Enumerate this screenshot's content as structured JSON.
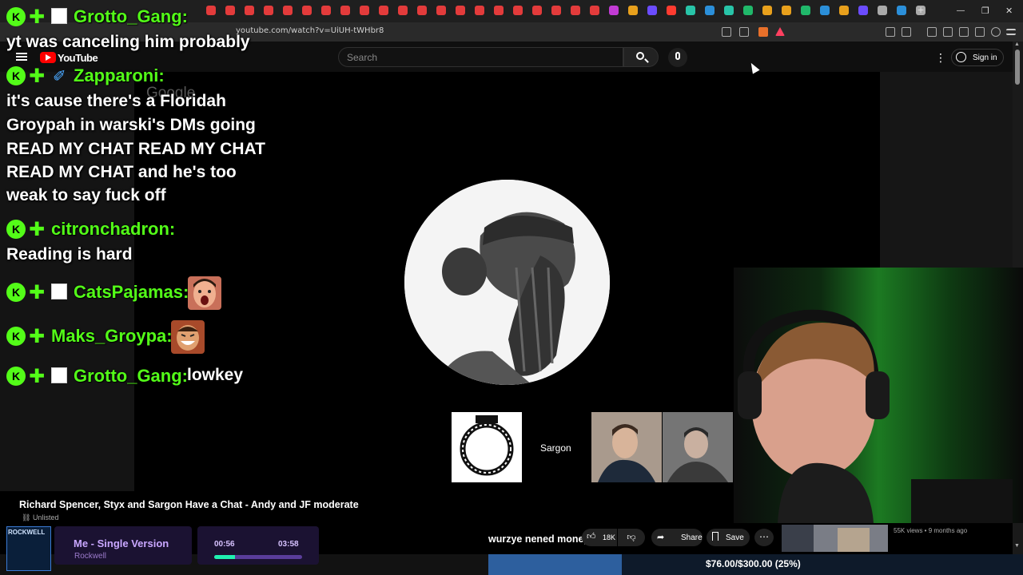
{
  "browser": {
    "url": "youtube.com/watch?v=UiUH-tWHbr8",
    "tab_icon_colors": [
      "#e33b3b",
      "#e33b3b",
      "#e33b3b",
      "#e33b3b",
      "#e33b3b",
      "#e33b3b",
      "#e33b3b",
      "#e33b3b",
      "#e33b3b",
      "#e33b3b",
      "#e33b3b",
      "#e33b3b",
      "#e33b3b",
      "#e33b3b",
      "#e33b3b",
      "#e33b3b",
      "#e33b3b",
      "#e33b3b",
      "#e33b3b",
      "#e33b3b",
      "#e33b3b",
      "#c23bd4",
      "#e8a01c",
      "#6b4cff",
      "#ff3b30",
      "#28c4a8",
      "#2b8fd9",
      "#28c4a8",
      "#20b86a",
      "#e8a01c",
      "#e8a01c",
      "#20b86a",
      "#2b8fd9",
      "#e8a01c",
      "#6b4cff",
      "#aaaaaa",
      "#2b8fd9",
      "#aaaaaa"
    ],
    "new_tab": "+",
    "minimize": "—",
    "maximize": "❐",
    "close": "✕"
  },
  "youtube": {
    "logo_text": "YouTube",
    "search_placeholder": "Search",
    "sign_in": "Sign in",
    "more": "⋮",
    "watermark": "Google"
  },
  "chat": {
    "brand_color": "#53fc18",
    "badge_letter": "K",
    "messages": [
      {
        "user": "Grotto_Gang:",
        "lines": [
          "yt was canceling him probably"
        ],
        "emote": null
      },
      {
        "user": "Zapparoni:",
        "lines": [
          "it's cause there's a Floridah",
          "Groypah in warski's DMs going",
          "READ MY CHAT READ MY CHAT",
          "READ MY CHAT and he's too",
          "weak to say fuck off"
        ],
        "emote": null
      },
      {
        "user": "citronchadron:",
        "lines": [
          "Reading is hard"
        ],
        "emote": null
      },
      {
        "user": "CatsPajamas:",
        "lines": [],
        "emote": "face"
      },
      {
        "user": "Maks_Groypa:",
        "lines": [],
        "emote": "laugh"
      },
      {
        "user": "Grotto_Gang:",
        "lines": [],
        "inline": "lowkey"
      }
    ]
  },
  "video": {
    "title": "Richard Spencer, Styx and Sargon Have a Chat - Andy and JF moderate",
    "visibility": "Unlisted",
    "participant_label": "Sargon"
  },
  "actions": {
    "likes": "18K",
    "share": "Share",
    "save": "Save",
    "more": "⋯"
  },
  "next_video": {
    "meta": "55K views • 9 months ago"
  },
  "now_playing": {
    "art_label": "ROCKWELL",
    "song": "Me - Single Version",
    "artist": "Rockwell",
    "elapsed": "00:56",
    "duration": "03:58",
    "progress": 0.235
  },
  "ticker": "wurzye nened money",
  "goal": {
    "text": "$76.00/$300.00 (25%)",
    "fraction": 0.25
  }
}
